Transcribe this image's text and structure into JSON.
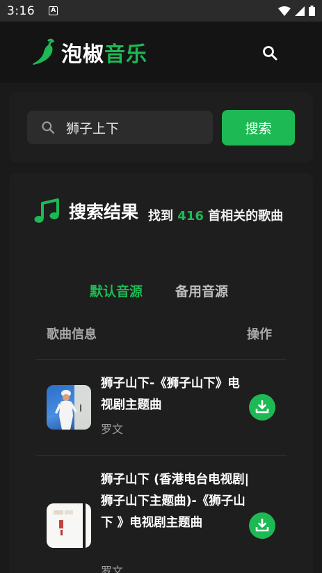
{
  "status_bar": {
    "time": "3:16",
    "notification_icon": "A"
  },
  "header": {
    "brand_part1": "泡椒",
    "brand_part2": "音乐",
    "logo_icon": "chili-pepper-icon",
    "search_icon": "search-icon"
  },
  "search": {
    "query": "狮子上下",
    "button_label": "搜索"
  },
  "results": {
    "title": "搜索结果",
    "count_prefix": "找到 ",
    "count": "416",
    "count_suffix": " 首相关的歌曲",
    "tabs": [
      {
        "label": "默认音源",
        "active": true
      },
      {
        "label": "备用音源",
        "active": false
      }
    ],
    "columns": {
      "info": "歌曲信息",
      "action": "操作"
    },
    "songs": [
      {
        "title": "狮子山下-《狮子山下》电视剧主题曲",
        "artist": "罗文"
      },
      {
        "title": "狮子山下 (香港电台电视剧|狮子山下主题曲)-《狮子山下 》电视剧主题曲",
        "artist": "罗文"
      }
    ]
  },
  "colors": {
    "accent": "#1db954",
    "background": "#1a1a1a",
    "card": "#1e1e1e",
    "header": "#141414"
  }
}
